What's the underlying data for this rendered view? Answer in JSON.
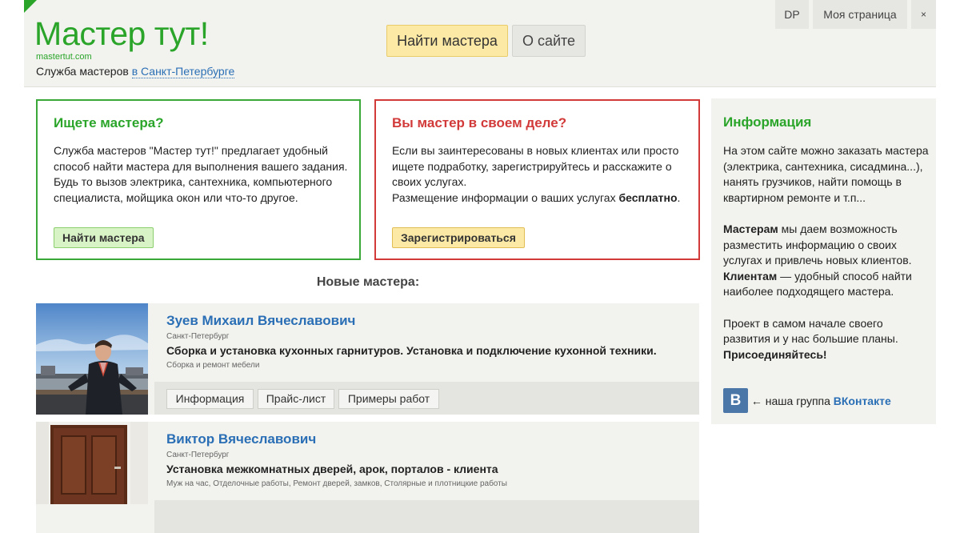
{
  "header": {
    "logo": "Мастер тут!",
    "domain": "mastertut.com",
    "tagline_prefix": "Служба мастеров",
    "city_link": "в Санкт-Петербурге",
    "nav": {
      "find": "Найти мастера",
      "about": "О сайте"
    },
    "top_right": {
      "dp": "DP",
      "my_page": "Моя страница",
      "close": "×"
    }
  },
  "looking_card": {
    "title": "Ищете мастера?",
    "text": "Служба мастеров \"Мастер тут!\" предлагает удобный способ найти мастера для выполнения вашего задания. Будь то вызов электрика, сантехника, компьютерного специалиста, мойщика окон или что-то другое.",
    "button": "Найти мастера"
  },
  "master_card": {
    "title": "Вы мастер в своем деле?",
    "text": "Если вы заинтересованы в новых клиентах или просто ищете подработку, зарегистрируйтесь и расскажите о своих услугах.",
    "text2": "Размещение информации о ваших услугах",
    "text2_bold": "бесплатно",
    "text2_end": ".",
    "button": "Зарегистрироваться"
  },
  "new_masters": {
    "title": "Новые мастера:",
    "items": [
      {
        "name": "Зуев Михаил Вячеславович",
        "city": "Санкт-Петербург",
        "headline": "Сборка и установка кухонных гарнитуров. Установка и подключение кухонной техники.",
        "categories": "Сборка и ремонт мебели",
        "tabs": [
          "Информация",
          "Прайс-лист",
          "Примеры работ"
        ]
      },
      {
        "name": "Виктор Вячеславович",
        "city": "Санкт-Петербург",
        "headline": "Установка межкомнатных дверей, арок, порталов - клиента",
        "categories": "Муж на час, Отделочные работы, Ремонт дверей, замков, Столярные и плотницкие работы"
      }
    ]
  },
  "sidebar": {
    "title": "Информация",
    "p1": "На этом сайте можно заказать мастера (электрика, сантехника, сисадмина...), нанять грузчиков, найти помощь в квартирном ремонте и т.п...",
    "p2_bold1": "Мастерам",
    "p2_text1": " мы даем возможность разместить информацию о своих услугах и привлечь новых клиентов.",
    "p2_bold2": "Клиентам",
    "p2_text2": " — удобный способ найти наиболее подходящего мастера.",
    "p3_text": "Проект в самом начале своего развития и у нас большие планы.",
    "p3_bold": "Присоединяйтесь!",
    "vk_icon_letter": "B",
    "vk_text": "← наша группа",
    "vk_link": "ВКонтакте"
  },
  "colors": {
    "brand_green": "#2aa52a",
    "alert_red": "#d23a3a",
    "link_blue": "#2a6fb5",
    "vk_blue": "#4a76a8"
  }
}
